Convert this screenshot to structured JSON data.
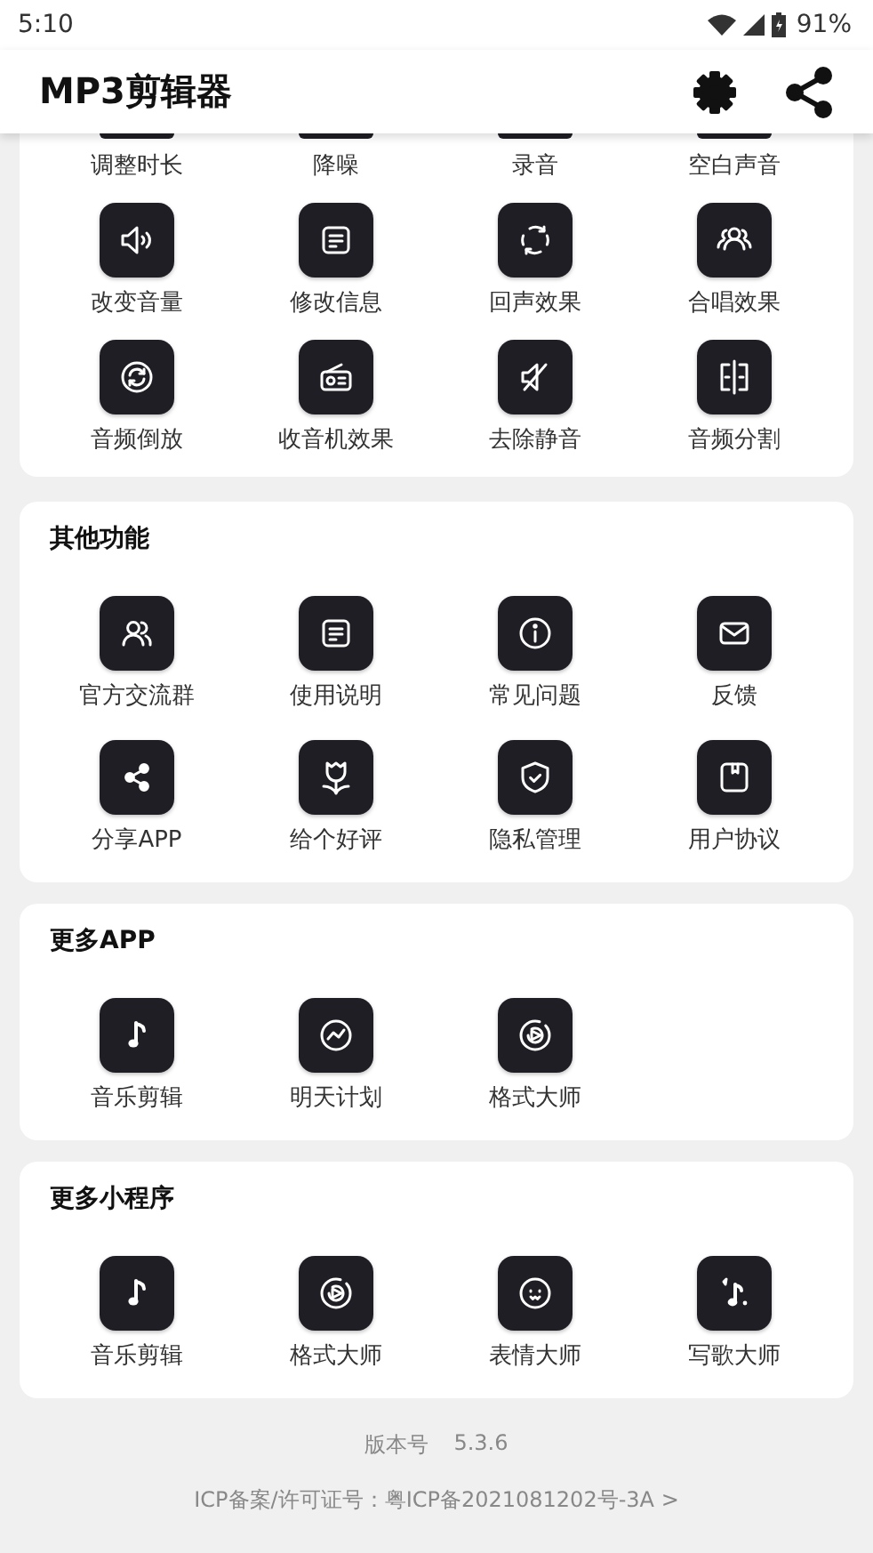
{
  "status_bar": {
    "time": "5:10",
    "battery": "91%"
  },
  "app_bar": {
    "title": "MP3剪辑器"
  },
  "sections": [
    {
      "cut_top": true,
      "items": [
        {
          "label": "调整时长"
        },
        {
          "label": "降噪"
        },
        {
          "label": "录音"
        },
        {
          "label": "空白声音"
        },
        {
          "label": "改变音量"
        },
        {
          "label": "修改信息"
        },
        {
          "label": "回声效果"
        },
        {
          "label": "合唱效果"
        },
        {
          "label": "音频倒放"
        },
        {
          "label": "收音机效果"
        },
        {
          "label": "去除静音"
        },
        {
          "label": "音频分割"
        }
      ]
    },
    {
      "title": "其他功能",
      "items": [
        {
          "label": "官方交流群"
        },
        {
          "label": "使用说明"
        },
        {
          "label": "常见问题"
        },
        {
          "label": "反馈"
        },
        {
          "label": "分享APP"
        },
        {
          "label": "给个好评"
        },
        {
          "label": "隐私管理"
        },
        {
          "label": "用户协议"
        }
      ]
    },
    {
      "title": "更多APP",
      "items": [
        {
          "label": "音乐剪辑"
        },
        {
          "label": "明天计划"
        },
        {
          "label": "格式大师"
        }
      ]
    },
    {
      "title": "更多小程序",
      "items": [
        {
          "label": "音乐剪辑"
        },
        {
          "label": "格式大师"
        },
        {
          "label": "表情大师"
        },
        {
          "label": "写歌大师"
        }
      ]
    }
  ],
  "footer": {
    "version_label": "版本号",
    "version": "5.3.6",
    "icp": "ICP备案/许可证号：粤ICP备2021081202号-3A >"
  }
}
